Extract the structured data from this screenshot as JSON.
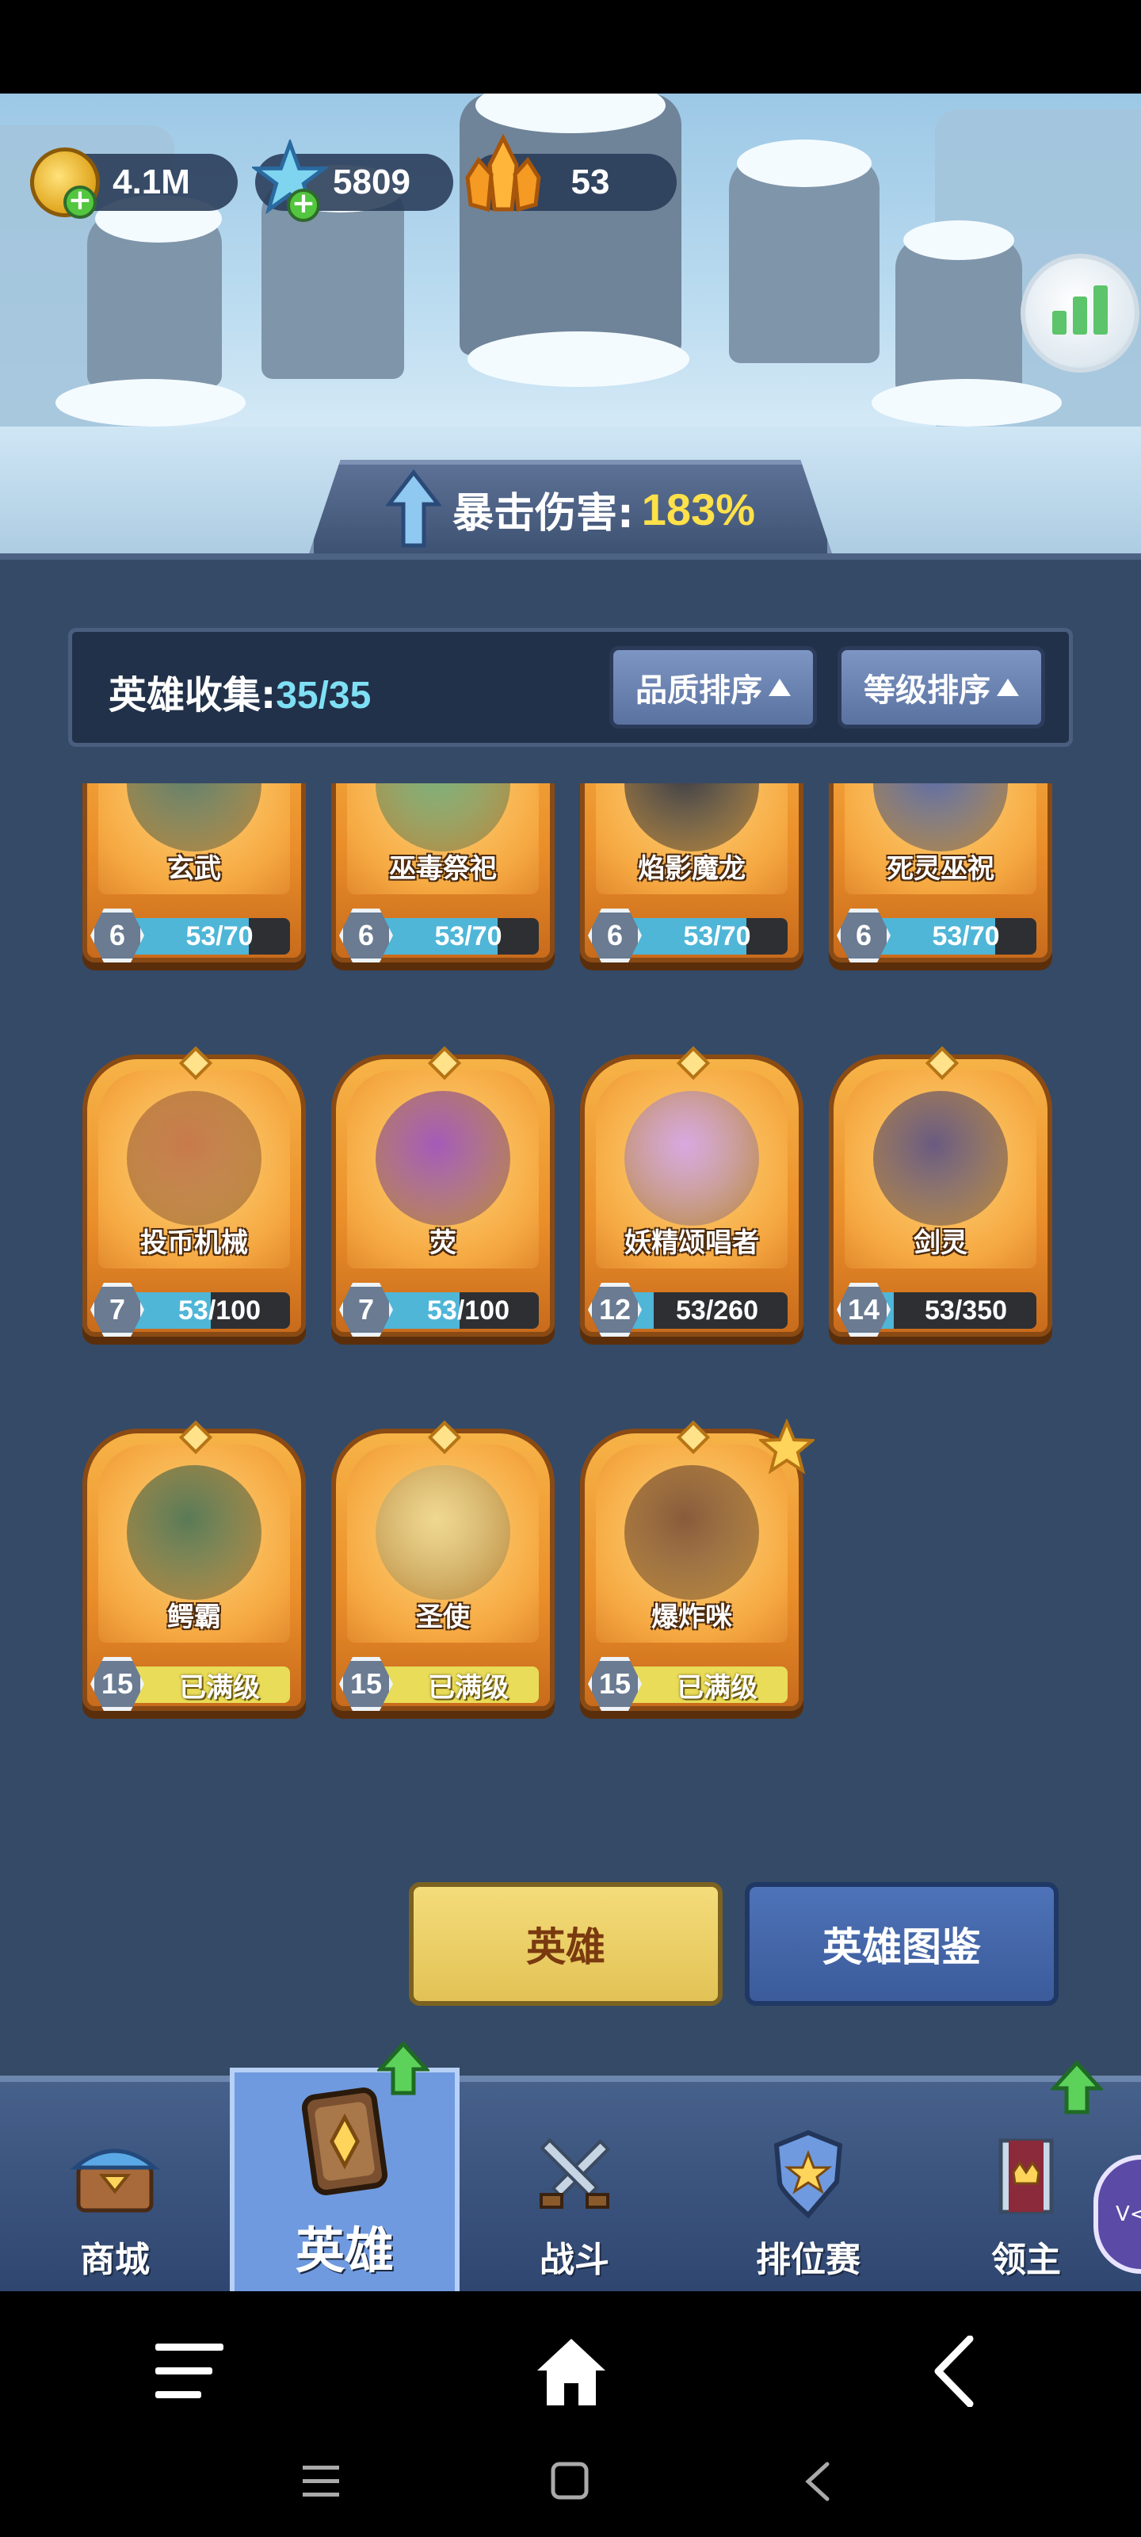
{
  "currencies": {
    "gold": "4.1M",
    "gems": "5809",
    "crystals": "53"
  },
  "crit_banner": {
    "label": "暴击伤害:",
    "value": "183%"
  },
  "collection": {
    "label": "英雄收集:",
    "count": "35/35",
    "sort_quality": "品质排序",
    "sort_level": "等级排序"
  },
  "heroes": [
    {
      "name": "玄武",
      "level": "6",
      "progress": "53/70",
      "fill": 0.757
    },
    {
      "name": "巫毒祭祀",
      "level": "6",
      "progress": "53/70",
      "fill": 0.757
    },
    {
      "name": "焰影魔龙",
      "level": "6",
      "progress": "53/70",
      "fill": 0.757
    },
    {
      "name": "死灵巫祝",
      "level": "6",
      "progress": "53/70",
      "fill": 0.757
    },
    {
      "name": "投币机械",
      "level": "7",
      "progress": "53/100",
      "fill": 0.53
    },
    {
      "name": "荧",
      "level": "7",
      "progress": "53/100",
      "fill": 0.53
    },
    {
      "name": "妖精颂唱者",
      "level": "12",
      "progress": "53/260",
      "fill": 0.204
    },
    {
      "name": "剑灵",
      "level": "14",
      "progress": "53/350",
      "fill": 0.151
    },
    {
      "name": "鳄霸",
      "level": "15",
      "progress": "已满级",
      "fill": 1
    },
    {
      "name": "圣使",
      "level": "15",
      "progress": "已满级",
      "fill": 1
    },
    {
      "name": "爆炸咪",
      "level": "15",
      "progress": "已满级",
      "fill": 1
    }
  ],
  "buttons": {
    "hero": "英雄",
    "codex": "英雄图鉴"
  },
  "nav": {
    "shop": "商城",
    "hero": "英雄",
    "battle": "战斗",
    "ranked": "排位赛",
    "lord": "领主"
  },
  "side_tab": "V<",
  "colors": {
    "panel": "#354a66",
    "card_orange": "#ea8e2a",
    "progress_blue": "#4fb6d8",
    "max_yellow": "#e9dc58",
    "accent_yellow": "#ffe14a"
  }
}
